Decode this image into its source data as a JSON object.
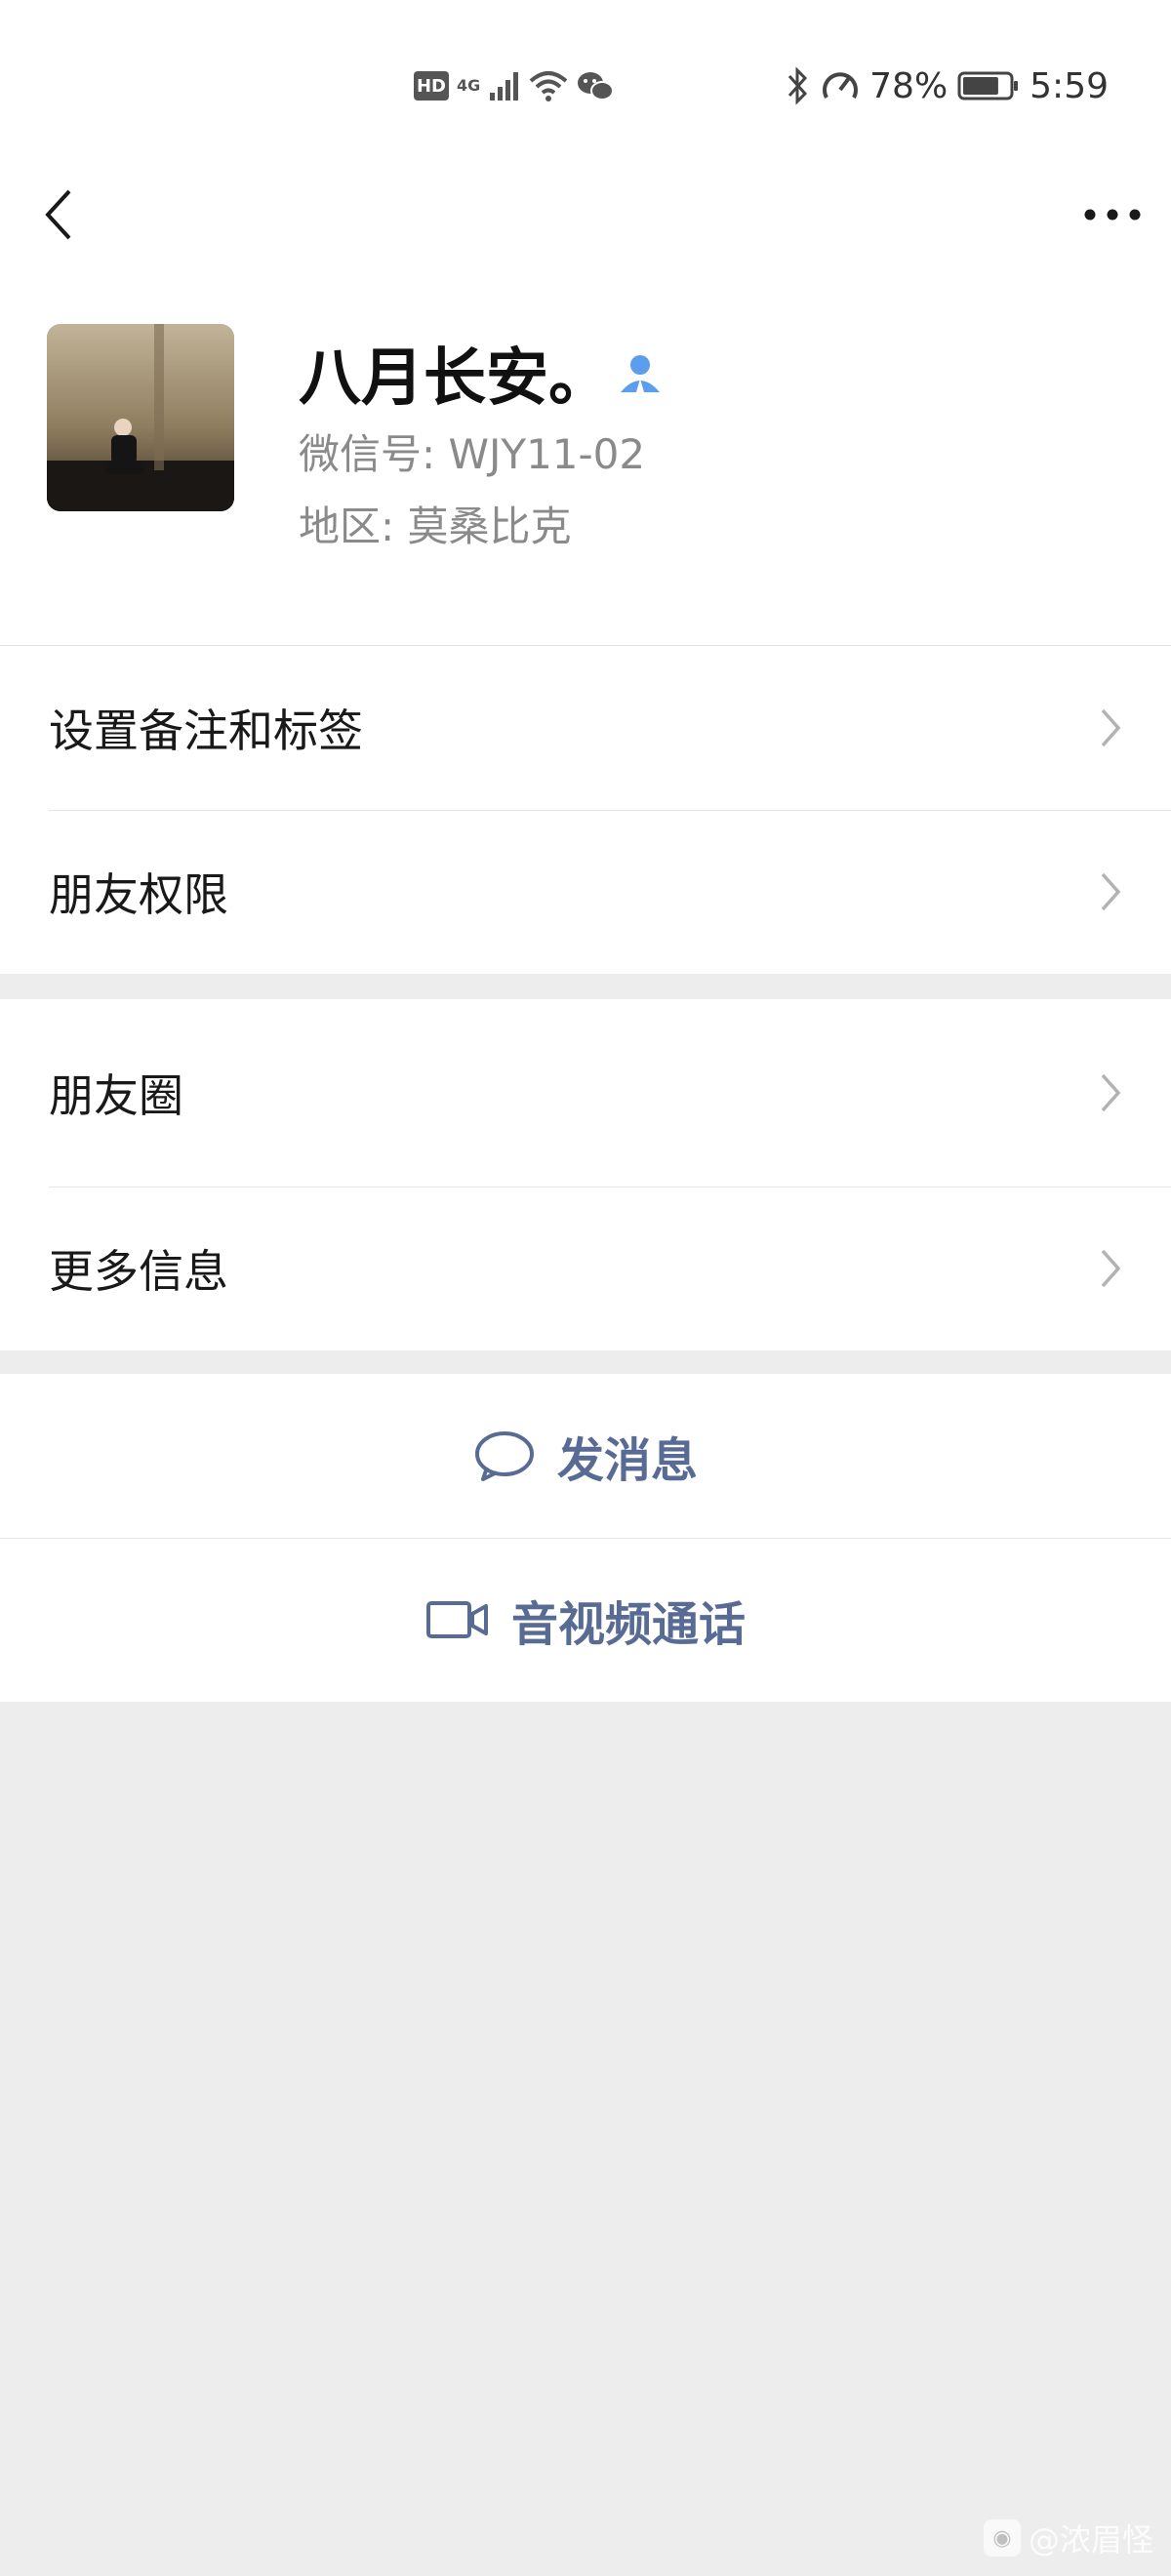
{
  "status_bar": {
    "network_badge": "HD",
    "network_type": "4G",
    "battery_percent": "78%",
    "battery_level": 0.78,
    "time": "5:59",
    "icons": [
      "hd-icon",
      "signal-icon",
      "wifi-icon",
      "wechat-icon",
      "bluetooth-icon",
      "speedometer-icon",
      "battery-icon"
    ]
  },
  "nav": {
    "back_icon": "chevron-left-icon",
    "more_icon": "more-dots-icon"
  },
  "profile": {
    "name": "八月长安。",
    "wechat_id_label": "微信号: ",
    "wechat_id": "WJY11-02",
    "region_label": "地区: ",
    "region": "莫桑比克",
    "badge_icon": "contact-person-icon"
  },
  "menu_group_1": {
    "items": [
      {
        "label": "设置备注和标签"
      },
      {
        "label": "朋友权限"
      }
    ]
  },
  "menu_group_2": {
    "items": [
      {
        "label": "朋友圈"
      },
      {
        "label": "更多信息"
      }
    ]
  },
  "actions": {
    "send_message": "发消息",
    "video_call": "音视频通话"
  },
  "watermark": {
    "text": "@浓眉怪"
  },
  "colors": {
    "link_blue": "#576b95",
    "background": "#ededed",
    "accent_badge": "#5c9ded"
  }
}
